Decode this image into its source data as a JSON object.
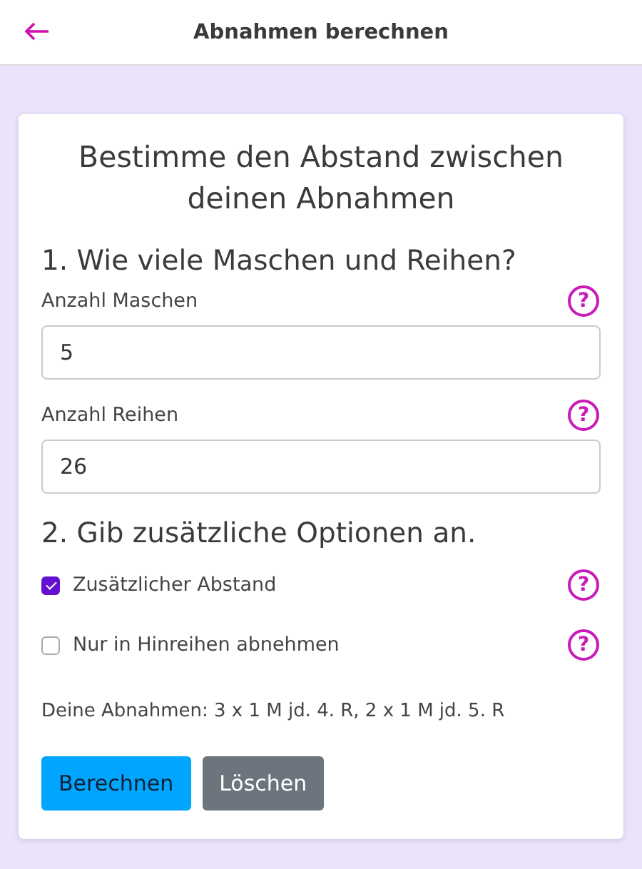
{
  "header": {
    "title": "Abnahmen berechnen"
  },
  "card": {
    "title": "Bestimme den Abstand zwischen deinen Abnahmen",
    "section_1": "1. Wie viele Maschen und Reihen?",
    "fields": [
      {
        "label": "Anzahl Maschen",
        "value": "5",
        "help": "?"
      },
      {
        "label": "Anzahl Reihen",
        "value": "26",
        "help": "?"
      }
    ],
    "section_2": "2. Gib zusätzliche Optionen an.",
    "options": [
      {
        "label": "Zusätzlicher Abstand",
        "checked": true,
        "help": "?"
      },
      {
        "label": "Nur in Hinreihen abnehmen",
        "checked": false,
        "help": "?"
      }
    ],
    "result": "Deine Abnahmen: 3 x 1 M jd. 4. R, 2 x 1 M jd. 5. R",
    "buttons": [
      {
        "label": "Berechnen",
        "kind": "primary"
      },
      {
        "label": "Löschen",
        "kind": "secondary"
      }
    ]
  }
}
